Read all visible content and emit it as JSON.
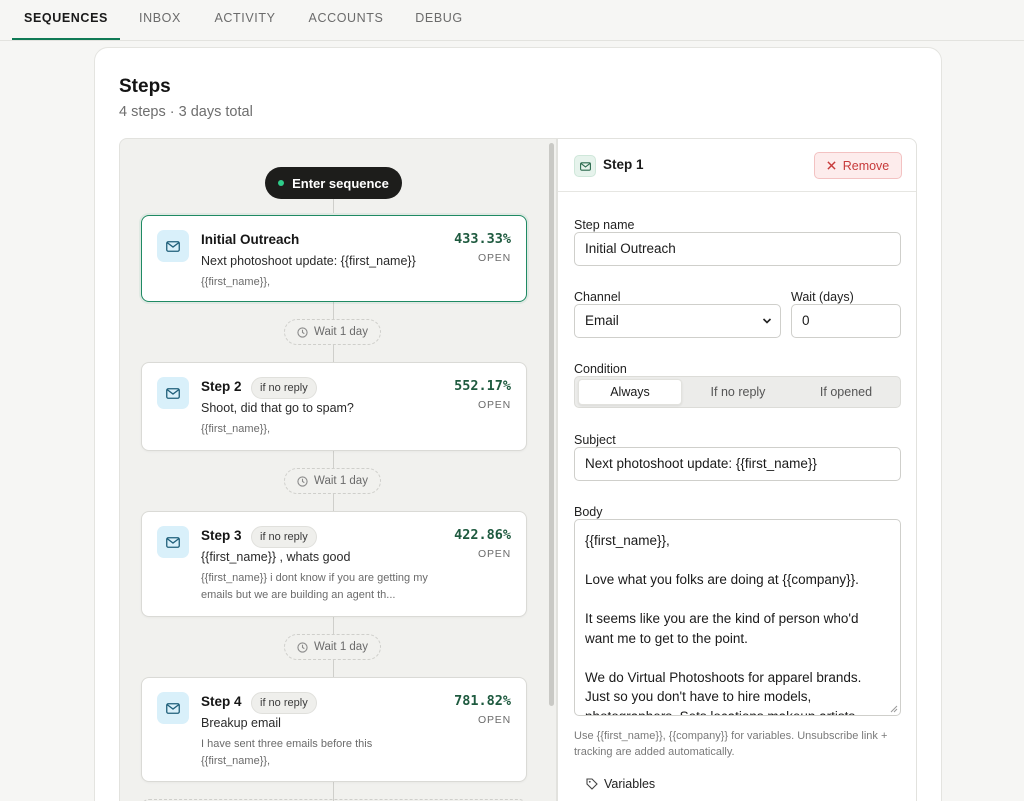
{
  "nav": {
    "tabs": [
      {
        "label": "SEQUENCES",
        "active": true
      },
      {
        "label": "INBOX",
        "active": false
      },
      {
        "label": "ACTIVITY",
        "active": false
      },
      {
        "label": "ACCOUNTS",
        "active": false
      },
      {
        "label": "DEBUG",
        "active": false
      }
    ]
  },
  "steps_panel": {
    "title": "Steps",
    "subtitle": "4 steps · 3 days total"
  },
  "flow": {
    "enter_label": "Enter sequence",
    "wait_label": "Wait 1 day",
    "steps": [
      {
        "name": "Initial Outreach",
        "badge": "",
        "subject": "Next photoshoot update: {{first_name}}",
        "preview": "{{first_name}},",
        "rate": "433.33%",
        "rate_label": "OPEN"
      },
      {
        "name": "Step 2",
        "badge": "if no reply",
        "subject": "Shoot, did that go to spam?",
        "preview": "{{first_name}},",
        "rate": "552.17%",
        "rate_label": "OPEN"
      },
      {
        "name": "Step 3",
        "badge": "if no reply",
        "subject": "{{first_name}} , whats good",
        "preview": "{{first_name}} i dont know if you are getting my emails but we are building an agent th...",
        "rate": "422.86%",
        "rate_label": "OPEN"
      },
      {
        "name": "Step 4",
        "badge": "if no reply",
        "subject": "Breakup email",
        "preview": "I have sent three emails before this {{first_name}},",
        "rate": "781.82%",
        "rate_label": "OPEN"
      }
    ]
  },
  "editor": {
    "title": "Step 1",
    "remove_label": "Remove",
    "step_name_label": "Step name",
    "step_name_value": "Initial Outreach",
    "channel_label": "Channel",
    "channel_value": "Email",
    "wait_label": "Wait (days)",
    "wait_value": "0",
    "condition_label": "Condition",
    "condition_options": [
      "Always",
      "If no reply",
      "If opened"
    ],
    "condition_selected": "Always",
    "subject_label": "Subject",
    "subject_value": "Next photoshoot update: {{first_name}}",
    "body_label": "Body",
    "body_lines": [
      "{{first_name}},",
      "",
      "Love what you folks are doing at {{company}}.",
      "",
      "It seems like you are the kind of person who'd",
      "want me to get to the point.",
      "",
      "We do Virtual Photoshoots for apparel brands.",
      "Just so you don't have to hire models,",
      "photographers, Sets locations makeup artists"
    ],
    "hint": "Use {{first_name}}, {{company}} for variables. Unsubscribe link + tracking are added automatically.",
    "variables_label": "Variables"
  },
  "colors": {
    "accent": "#0f7a55",
    "rate_text": "#1e5a3f",
    "remove_text": "#c73a3a",
    "mail_icon_bg": "#d9f0fa"
  },
  "icons": [
    "mail-icon",
    "clock-icon",
    "close-icon",
    "chevron-down-icon",
    "tag-icon"
  ]
}
